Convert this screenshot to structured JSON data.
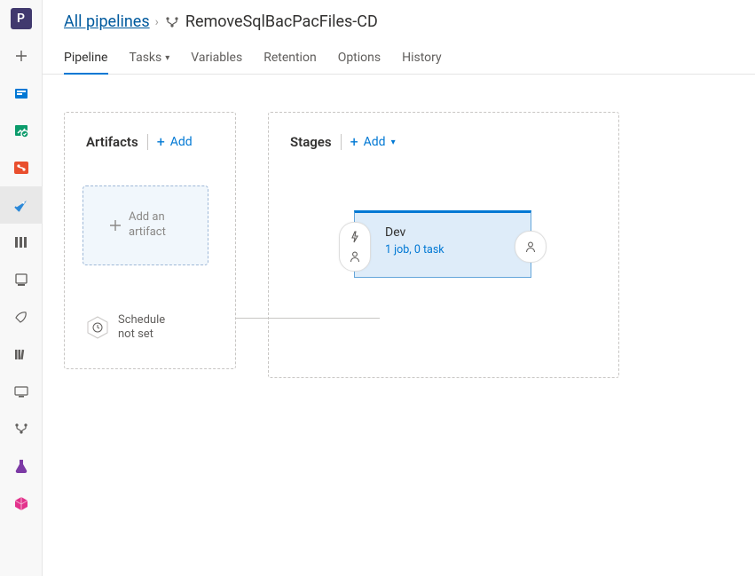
{
  "rail": {
    "project_initial": "P"
  },
  "breadcrumb": {
    "all_pipelines_label": "All pipelines",
    "pipeline_title": "RemoveSqlBacPacFiles-CD"
  },
  "tabs": {
    "pipeline": "Pipeline",
    "tasks": "Tasks",
    "variables": "Variables",
    "retention": "Retention",
    "options": "Options",
    "history": "History"
  },
  "artifacts_panel": {
    "title": "Artifacts",
    "add_label": "Add",
    "add_artifact_label": "Add an artifact",
    "schedule_label": "Schedule not set"
  },
  "stages_panel": {
    "title": "Stages",
    "add_label": "Add",
    "stages": [
      {
        "name": "Dev",
        "summary": "1 job, 0 task"
      }
    ]
  }
}
